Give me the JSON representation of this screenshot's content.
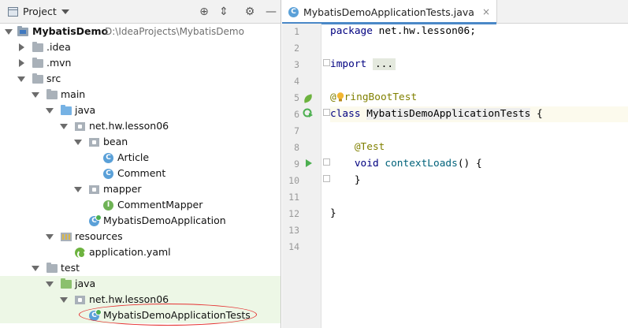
{
  "project_panel": {
    "title": "Project",
    "tree": [
      {
        "label": "MybatisDemo",
        "path": "D:\\IdeaProjects\\MybatisDemo"
      },
      {
        "label": ".idea"
      },
      {
        "label": ".mvn"
      },
      {
        "label": "src"
      },
      {
        "label": "main"
      },
      {
        "label": "java"
      },
      {
        "label": "net.hw.lesson06"
      },
      {
        "label": "bean"
      },
      {
        "label": "Article"
      },
      {
        "label": "Comment"
      },
      {
        "label": "mapper"
      },
      {
        "label": "CommentMapper"
      },
      {
        "label": "MybatisDemoApplication"
      },
      {
        "label": "resources"
      },
      {
        "label": "application.yaml"
      },
      {
        "label": "test"
      },
      {
        "label": "java"
      },
      {
        "label": "net.hw.lesson06"
      },
      {
        "label": "MybatisDemoApplicationTests"
      }
    ],
    "icons": {
      "class_letter": "C",
      "interface_letter": "I"
    }
  },
  "editor": {
    "tab": {
      "label": "MybatisDemoApplicationTests.java",
      "close": "×"
    },
    "line_numbers": [
      "1",
      "2",
      "3",
      "4",
      "5",
      "6",
      "7",
      "8",
      "9",
      "10",
      "11",
      "12",
      "13",
      "14"
    ],
    "lines": {
      "l1_kw": "package",
      "l1_rest": " net.hw.lesson06;",
      "l3_kw": "import",
      "l3_fold": "...",
      "l6_at": "@",
      "l6_ann": "ringBootTest",
      "l7_kw": "class",
      "l7_name": "MybatisDemoApplicationTests",
      "l7_brace": "{",
      "l9_ann": "@Test",
      "l10_kw": "void",
      "l10_name": "contextLoads",
      "l10_rest": "() {",
      "l11": "}",
      "l13": "}"
    }
  },
  "colors": {
    "keyword": "#000080",
    "annotation": "#808000",
    "selection_green": "#edf7e6",
    "highlight_ellipse": "#e53030"
  }
}
